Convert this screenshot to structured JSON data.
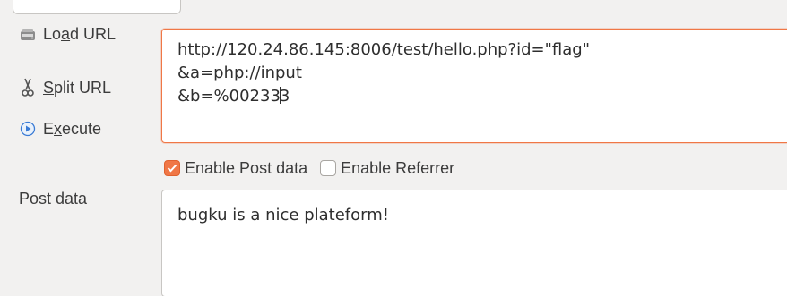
{
  "toolbar": {
    "load_url": {
      "prefix": "Lo",
      "mnemonic": "a",
      "suffix": "d URL",
      "icon": "load-url-icon"
    },
    "split_url": {
      "prefix": "",
      "mnemonic": "S",
      "suffix": "plit URL",
      "icon": "split-url-icon"
    },
    "execute": {
      "prefix": "E",
      "mnemonic": "x",
      "suffix": "ecute",
      "icon": "execute-icon"
    }
  },
  "url_field": {
    "line1": "http://120.24.86.145:8006/test/hello.php?id=\"flag\"",
    "line2": "&a=php://input",
    "line3_before_caret": "&b=%00233",
    "line3_after_caret": "3"
  },
  "options": {
    "enable_post_data": {
      "label": "Enable Post data",
      "checked": true
    },
    "enable_referrer": {
      "label": "Enable Referrer",
      "checked": false
    }
  },
  "post_data": {
    "label": "Post data",
    "value": "bugku is a nice plateform!"
  },
  "colors": {
    "accent": "#f07746",
    "background": "#f2f1f0",
    "execute_icon": "#3a7bd5"
  }
}
